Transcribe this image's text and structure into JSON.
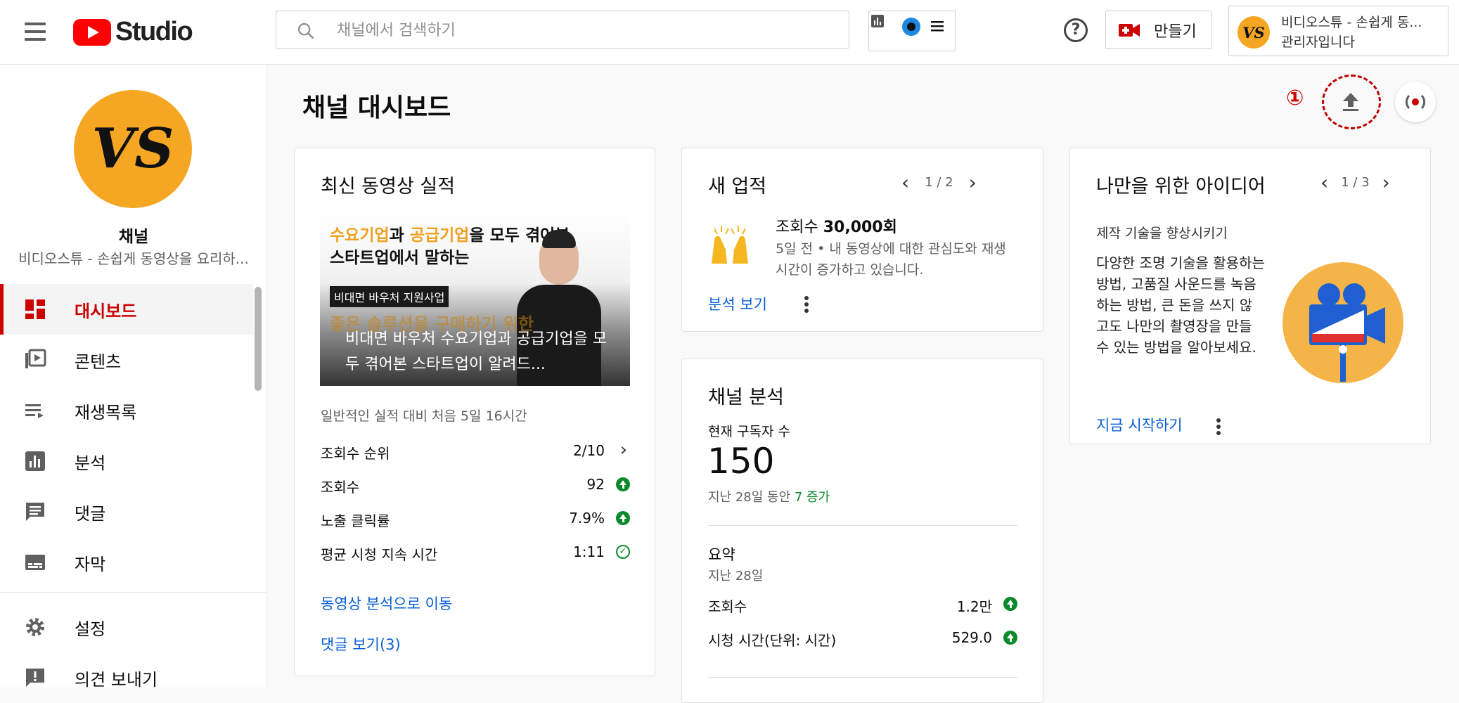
{
  "header": {
    "logo_text": "Studio",
    "search_placeholder": "채널에서 검색하기",
    "create_label": "만들기",
    "account_name": "비디오스튜 - 손쉽게 동...",
    "account_role": "관리자입니다",
    "avatar_initials": "VS"
  },
  "sidebar": {
    "channel_title": "채널",
    "channel_subtitle": "비디오스튜 - 손쉽게 동영상을 요리하...",
    "items": [
      {
        "label": "대시보드",
        "icon": "dashboard-icon",
        "active": true
      },
      {
        "label": "콘텐츠",
        "icon": "content-icon"
      },
      {
        "label": "재생목록",
        "icon": "playlist-icon"
      },
      {
        "label": "분석",
        "icon": "analytics-icon"
      },
      {
        "label": "댓글",
        "icon": "comments-icon"
      },
      {
        "label": "자막",
        "icon": "subtitles-icon"
      },
      {
        "label": "설정",
        "icon": "settings-icon"
      },
      {
        "label": "의견 보내기",
        "icon": "feedback-icon"
      }
    ]
  },
  "main": {
    "page_title": "채널 대시보드",
    "annotation_number": "①"
  },
  "latest_video": {
    "title": "최신 동영상 실적",
    "thumb_headline_1a": "수요기업",
    "thumb_headline_1b": "과 ",
    "thumb_headline_1c": "공급기업",
    "thumb_headline_1d": "을 모두 겪어본",
    "thumb_headline_2": "스타트업에서 말하는",
    "thumb_tag": "비대면 바우처 지원사업",
    "thumb_bg_text": "좋은 솔루션을 구매하기 위한",
    "video_title": "비대면 바우처 수요기업과 공급기업을 모두 겪어본 스타트업이 알려드...",
    "compare_text": "일반적인 실적 대비 처음 5일 16시간",
    "rows": [
      {
        "label": "조회수 순위",
        "value": "2/10",
        "indicator": "chevron"
      },
      {
        "label": "조회수",
        "value": "92",
        "indicator": "up"
      },
      {
        "label": "노출 클릭률",
        "value": "7.9%",
        "indicator": "up"
      },
      {
        "label": "평균 시청 지속 시간",
        "value": "1:11",
        "indicator": "check"
      }
    ],
    "link_analytics": "동영상 분석으로 이동",
    "link_comments": "댓글 보기(3)"
  },
  "new_achievement": {
    "title": "새 업적",
    "pager": "1 / 2",
    "headline_prefix": "조회수 ",
    "headline_bold": "30,000회",
    "desc": "5일 전 • 내 동영상에 대한 관심도와 재생 시간이 증가하고 있습니다.",
    "link": "분석 보기"
  },
  "channel_analytics": {
    "title": "채널 분석",
    "subs_label": "현재 구독자 수",
    "subs_value": "150",
    "subs_change_prefix": "지난 28일 동안 ",
    "subs_change": "7 증가",
    "summary_title": "요약",
    "summary_period": "지난 28일",
    "rows": [
      {
        "label": "조회수",
        "value": "1.2만"
      },
      {
        "label": "시청 시간(단위: 시간)",
        "value": "529.0"
      }
    ]
  },
  "ideas": {
    "title": "나만을 위한 아이디어",
    "pager": "1 / 3",
    "subtitle": "제작 기술을 향상시키기",
    "body": "다양한 조명 기술을 활용하는 방법, 고품질 사운드를 녹음하는 방법, 큰 돈을 쓰지 않고도 나만의 촬영장을 만들 수 있는 방법을 알아보세요.",
    "link": "지금 시작하기"
  },
  "colors": {
    "accent_red": "#cc0000",
    "link_blue": "#065fd4",
    "positive_green": "#0a8a2a",
    "avatar_orange": "#f5a623"
  }
}
